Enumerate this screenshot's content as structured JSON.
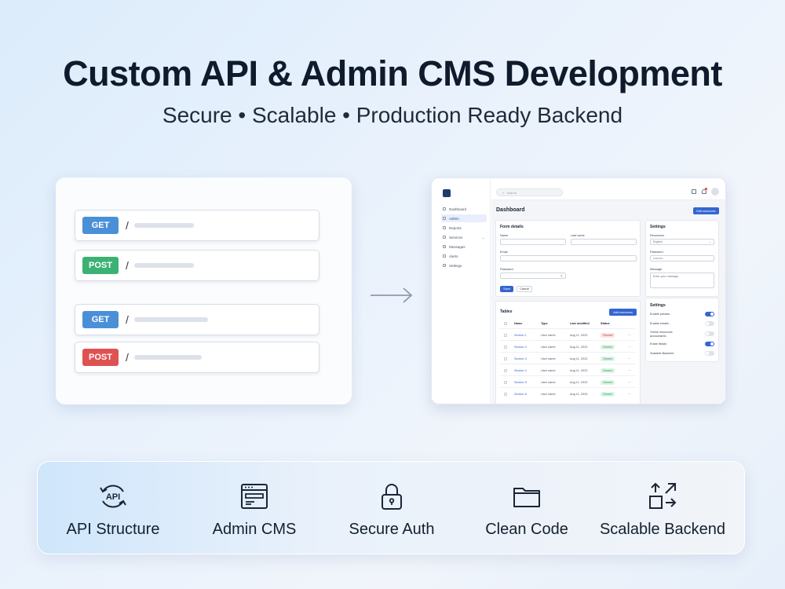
{
  "hero": {
    "title": "Custom API & Admin CMS Development",
    "subtitle": "Secure • Scalable • Production Ready Backend"
  },
  "api_card": {
    "endpoints": [
      {
        "method": "GET",
        "color": "#4a90d9",
        "path": "/"
      },
      {
        "method": "POST",
        "color": "#3bb273",
        "path": "/"
      },
      {
        "method": "GET",
        "color": "#4a90d9",
        "path": "/"
      },
      {
        "method": "POST",
        "color": "#e05252",
        "path": "/"
      }
    ]
  },
  "dashboard": {
    "search_placeholder": "Search",
    "nav": [
      "Dashboard",
      "Admin",
      "Reports",
      "Services",
      "Messages",
      "Alerts",
      "Settings"
    ],
    "page_title": "Dashboard",
    "header_button": "Edit resources",
    "form": {
      "title": "Form details",
      "name_label": "Name",
      "last_name_label": "Last name",
      "email_label": "Email",
      "password_label": "Password",
      "save": "Save",
      "cancel": "Cancel"
    },
    "settings_form": {
      "title": "Settings",
      "resources_label": "Resources",
      "language_value": "English",
      "password_label": "Password",
      "password_value": "••••••••••",
      "message_label": "Message",
      "message_placeholder": "Enter your message"
    },
    "table": {
      "title": "Tables",
      "button": "Add resources",
      "columns": [
        "Name",
        "Type",
        "Last modified",
        "Status"
      ],
      "rows": [
        {
          "name": "Section 1",
          "type": "User name",
          "date": "Aug 11, 2023",
          "status": "Planned",
          "tone": "red"
        },
        {
          "name": "Section 2",
          "type": "User name",
          "date": "Aug 11, 2023",
          "status": "Cleared",
          "tone": "green"
        },
        {
          "name": "Section 3",
          "type": "User name",
          "date": "Aug 11, 2023",
          "status": "Cleared",
          "tone": "green"
        },
        {
          "name": "Section 4",
          "type": "User name",
          "date": "Aug 11, 2023",
          "status": "Cleared",
          "tone": "green"
        },
        {
          "name": "Section 5",
          "type": "User name",
          "date": "Aug 11, 2023",
          "status": "Cleared",
          "tone": "green"
        },
        {
          "name": "Section 6",
          "type": "User name",
          "date": "Aug 11, 2023",
          "status": "Cleared",
          "tone": "green"
        }
      ],
      "row_menu": "···"
    },
    "toggles": {
      "title": "Settings",
      "items": [
        {
          "label": "Enable presets",
          "on": true
        },
        {
          "label": "Enable emails",
          "on": false
        },
        {
          "label": "Online resources accountants",
          "on": false
        },
        {
          "label": "Erase libado",
          "on": true
        },
        {
          "label": "Scalable Backend",
          "on": false
        }
      ]
    }
  },
  "features": [
    {
      "label": "API Structure",
      "icon": "api-cycle-icon"
    },
    {
      "label": "Admin CMS",
      "icon": "browser-window-icon"
    },
    {
      "label": "Secure Auth",
      "icon": "padlock-icon"
    },
    {
      "label": "Clean Code",
      "icon": "folder-icon"
    },
    {
      "label": "Scalable Backend",
      "icon": "scale-arrows-icon"
    }
  ],
  "colors": {
    "accent": "#3366d1",
    "title": "#0f1b2d"
  }
}
